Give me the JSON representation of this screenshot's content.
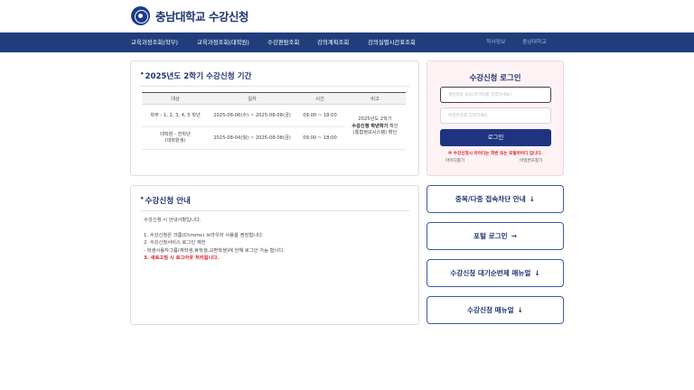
{
  "header": {
    "logo_text": "충남대학교 수강신청",
    "logo_icon": "university-emblem-icon"
  },
  "nav": {
    "items": [
      "교육과정조회(학부)",
      "교육과정조회(대학원)",
      "수강편람조회",
      "강의계획조회",
      "강의실별시간표조회"
    ],
    "sub_items": [
      "학사정보",
      "충남대학교"
    ]
  },
  "period": {
    "title": "2025년도 2학기 수강신청 기간",
    "headers": [
      "대상",
      "일자",
      "시간",
      "비고"
    ],
    "rows": [
      {
        "target": "학부 - 1, 2, 3, 4, 5 학년",
        "date": "2025-08-06(수) ~ 2025-08-08(금)",
        "time": "09:00 ~ 18:00"
      },
      {
        "target_line1": "대학원 - 전학년",
        "target_line2": "(대학원생)",
        "date": "2025-08-04(월) ~ 2025-08-08(금)",
        "time": "09:00 ~ 18:00"
      }
    ],
    "note_line1": "2025년도 2학기",
    "note_bold": "수강신청 학년학기",
    "note_after": " 확인",
    "note_line3": "(통합정보시스템) 확인"
  },
  "guide": {
    "title": "수강신청 안내",
    "intro": "수강신청 시 안내사항입니다.",
    "line1": "1. 수강신청은 크롬(Chrome) 브라우저 사용을 권장합니다.",
    "line2": "2. 수강신청서비스 로그인 제한",
    "line3": "- 학생사용자그룹(재학생,휴학생,교환학생)에 한해 로그인 가능 합니다.",
    "line4": "3. 새로고침 시 로그아웃 처리됩니다."
  },
  "login": {
    "title": "수강신청 로그인",
    "id_placeholder": "개인정보 보호(아이디를 입력하세요)",
    "pw_placeholder": "비밀번호를 입력하세요",
    "button_label": "로그인",
    "warning": "※ 수강신청시 아이디는 학번 또는 포털아이디 입니다.",
    "find_id": "아이디찾기",
    "find_pw": "비밀번호찾기"
  },
  "side_buttons": [
    {
      "label": "중복/다중 접속차단 안내",
      "icon": "↓",
      "icon_name": "download-icon"
    },
    {
      "label": "포털 로그인",
      "icon": "→",
      "icon_name": "arrow-right-icon"
    },
    {
      "label": "수강신청 대기순번제 매뉴얼",
      "icon": "↓",
      "icon_name": "download-icon"
    },
    {
      "label": "수강신청 매뉴얼",
      "icon": "↓",
      "icon_name": "download-icon"
    }
  ],
  "colors": {
    "nav_bg": "#213d7c",
    "brand": "#1d3572",
    "login_bg": "#fdf2f4",
    "warning": "#d9232a"
  }
}
